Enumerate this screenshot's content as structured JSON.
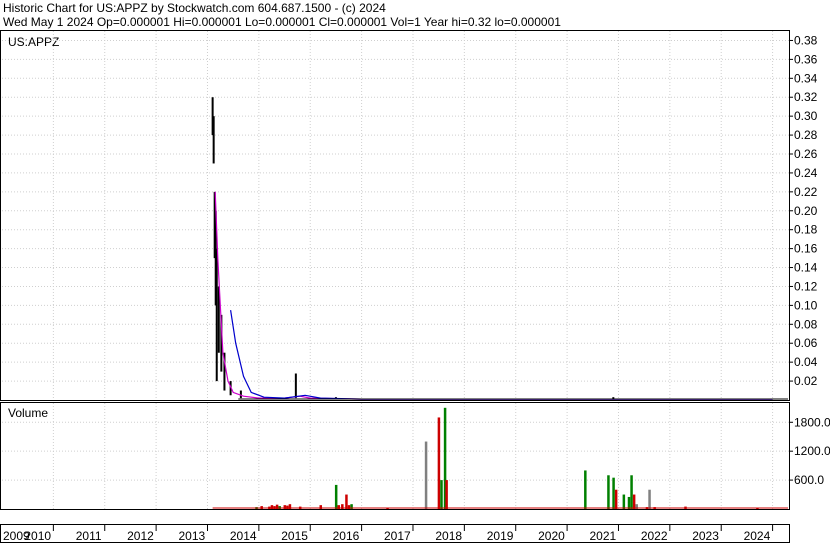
{
  "header": {
    "line1": "Historic Chart for US:APPZ by Stockwatch.com 604.687.1500 - (c) 2024",
    "line2": "Wed May  1 2024   Op=0.000001   Hi=0.000001   Lo=0.000001   Cl=0.000001   Vol=1   Year hi=0.32   lo=0.000001"
  },
  "chart_data": [
    {
      "type": "line",
      "title": "US:APPZ",
      "ylim": [
        0,
        0.39
      ],
      "y_ticks": [
        "0.38",
        "0.36",
        "0.34",
        "0.32",
        "0.30",
        "0.28",
        "0.26",
        "0.24",
        "0.22",
        "0.20",
        "0.18",
        "0.16",
        "0.14",
        "0.12",
        "0.10",
        "0.08",
        "0.06",
        "0.04",
        "0.02"
      ],
      "grid": true,
      "series": [
        {
          "kind": "price_high_low",
          "color": "#000000",
          "points": [
            {
              "x": 2013.1,
              "lo": 0.28,
              "hi": 0.32
            },
            {
              "x": 2013.12,
              "lo": 0.25,
              "hi": 0.3
            },
            {
              "x": 2013.14,
              "lo": 0.15,
              "hi": 0.22
            },
            {
              "x": 2013.16,
              "lo": 0.1,
              "hi": 0.2
            },
            {
              "x": 2013.18,
              "lo": 0.02,
              "hi": 0.16
            },
            {
              "x": 2013.22,
              "lo": 0.05,
              "hi": 0.12
            },
            {
              "x": 2013.27,
              "lo": 0.03,
              "hi": 0.09
            },
            {
              "x": 2013.33,
              "lo": 0.01,
              "hi": 0.05
            },
            {
              "x": 2013.45,
              "lo": 0.005,
              "hi": 0.02
            },
            {
              "x": 2013.65,
              "lo": 0.002,
              "hi": 0.01
            },
            {
              "x": 2014.72,
              "lo": 0.002,
              "hi": 0.028
            },
            {
              "x": 2015.5,
              "lo": 0.001,
              "hi": 0.003
            },
            {
              "x": 2020.9,
              "lo": 0.0005,
              "hi": 0.003
            }
          ]
        },
        {
          "kind": "moving_average",
          "color": "#cc00cc",
          "points": [
            [
              2013.15,
              0.22
            ],
            [
              2013.2,
              0.15
            ],
            [
              2013.25,
              0.1
            ],
            [
              2013.3,
              0.05
            ],
            [
              2013.4,
              0.02
            ],
            [
              2013.5,
              0.008
            ],
            [
              2013.7,
              0.004
            ],
            [
              2014.0,
              0.002
            ],
            [
              2014.5,
              0.002
            ],
            [
              2014.8,
              0.004
            ],
            [
              2015.0,
              0.002
            ],
            [
              2016.0,
              0.001
            ],
            [
              2024.0,
              0.001
            ]
          ]
        },
        {
          "kind": "moving_average",
          "color": "#0000cc",
          "points": [
            [
              2013.45,
              0.095
            ],
            [
              2013.55,
              0.06
            ],
            [
              2013.7,
              0.025
            ],
            [
              2013.85,
              0.008
            ],
            [
              2014.1,
              0.003
            ],
            [
              2014.5,
              0.002
            ],
            [
              2014.9,
              0.005
            ],
            [
              2015.2,
              0.002
            ],
            [
              2016.0,
              0.001
            ],
            [
              2024.0,
              0.001
            ]
          ]
        }
      ]
    },
    {
      "type": "bar",
      "title": "Volume",
      "ylim": [
        0,
        2200
      ],
      "y_ticks": [
        "1800.0",
        "1200.0",
        "600.0"
      ],
      "grid": true,
      "bars": [
        {
          "x": 2013.95,
          "v": 40,
          "c": "#008000"
        },
        {
          "x": 2014.05,
          "v": 60,
          "c": "#cc0000"
        },
        {
          "x": 2014.2,
          "v": 50,
          "c": "#cc0000"
        },
        {
          "x": 2014.25,
          "v": 80,
          "c": "#cc0000"
        },
        {
          "x": 2014.3,
          "v": 60,
          "c": "#cc0000"
        },
        {
          "x": 2014.35,
          "v": 90,
          "c": "#cc0000"
        },
        {
          "x": 2014.4,
          "v": 60,
          "c": "#008000"
        },
        {
          "x": 2014.5,
          "v": 80,
          "c": "#cc0000"
        },
        {
          "x": 2014.55,
          "v": 70,
          "c": "#cc0000"
        },
        {
          "x": 2014.6,
          "v": 100,
          "c": "#cc0000"
        },
        {
          "x": 2014.8,
          "v": 50,
          "c": "#cc0000"
        },
        {
          "x": 2015.2,
          "v": 80,
          "c": "#cc0000"
        },
        {
          "x": 2015.5,
          "v": 500,
          "c": "#008000"
        },
        {
          "x": 2015.55,
          "v": 80,
          "c": "#cc0000"
        },
        {
          "x": 2015.62,
          "v": 100,
          "c": "#cc0000"
        },
        {
          "x": 2015.7,
          "v": 300,
          "c": "#cc0000"
        },
        {
          "x": 2015.75,
          "v": 80,
          "c": "#cc0000"
        },
        {
          "x": 2015.8,
          "v": 100,
          "c": "#008000"
        },
        {
          "x": 2016.5,
          "v": 30,
          "c": "#cc0000"
        },
        {
          "x": 2017.25,
          "v": 1400,
          "c": "#808080"
        },
        {
          "x": 2017.5,
          "v": 1900,
          "c": "#cc0000"
        },
        {
          "x": 2017.55,
          "v": 600,
          "c": "#008000"
        },
        {
          "x": 2017.62,
          "v": 2100,
          "c": "#008000"
        },
        {
          "x": 2017.65,
          "v": 600,
          "c": "#cc0000"
        },
        {
          "x": 2020.35,
          "v": 800,
          "c": "#008000"
        },
        {
          "x": 2020.8,
          "v": 700,
          "c": "#008000"
        },
        {
          "x": 2020.9,
          "v": 650,
          "c": "#008000"
        },
        {
          "x": 2020.95,
          "v": 400,
          "c": "#cc0000"
        },
        {
          "x": 2021.1,
          "v": 300,
          "c": "#008000"
        },
        {
          "x": 2021.2,
          "v": 250,
          "c": "#008000"
        },
        {
          "x": 2021.25,
          "v": 700,
          "c": "#008000"
        },
        {
          "x": 2021.3,
          "v": 300,
          "c": "#cc0000"
        },
        {
          "x": 2021.35,
          "v": 100,
          "c": "#808080"
        },
        {
          "x": 2021.55,
          "v": 40,
          "c": "#cc0000"
        },
        {
          "x": 2021.6,
          "v": 400,
          "c": "#808080"
        },
        {
          "x": 2021.7,
          "v": 40,
          "c": "#cc0000"
        },
        {
          "x": 2022.3,
          "v": 50,
          "c": "#cc0000"
        },
        {
          "x": 2023.7,
          "v": 30,
          "c": "#cc0000"
        }
      ]
    }
  ],
  "x_axis": {
    "labels": [
      "2009",
      "2010",
      "2011",
      "2012",
      "2013",
      "2014",
      "2015",
      "2016",
      "2017",
      "2018",
      "2019",
      "2020",
      "2021",
      "2022",
      "2023",
      "2024"
    ],
    "xlim": [
      2009.0,
      2024.3
    ]
  }
}
